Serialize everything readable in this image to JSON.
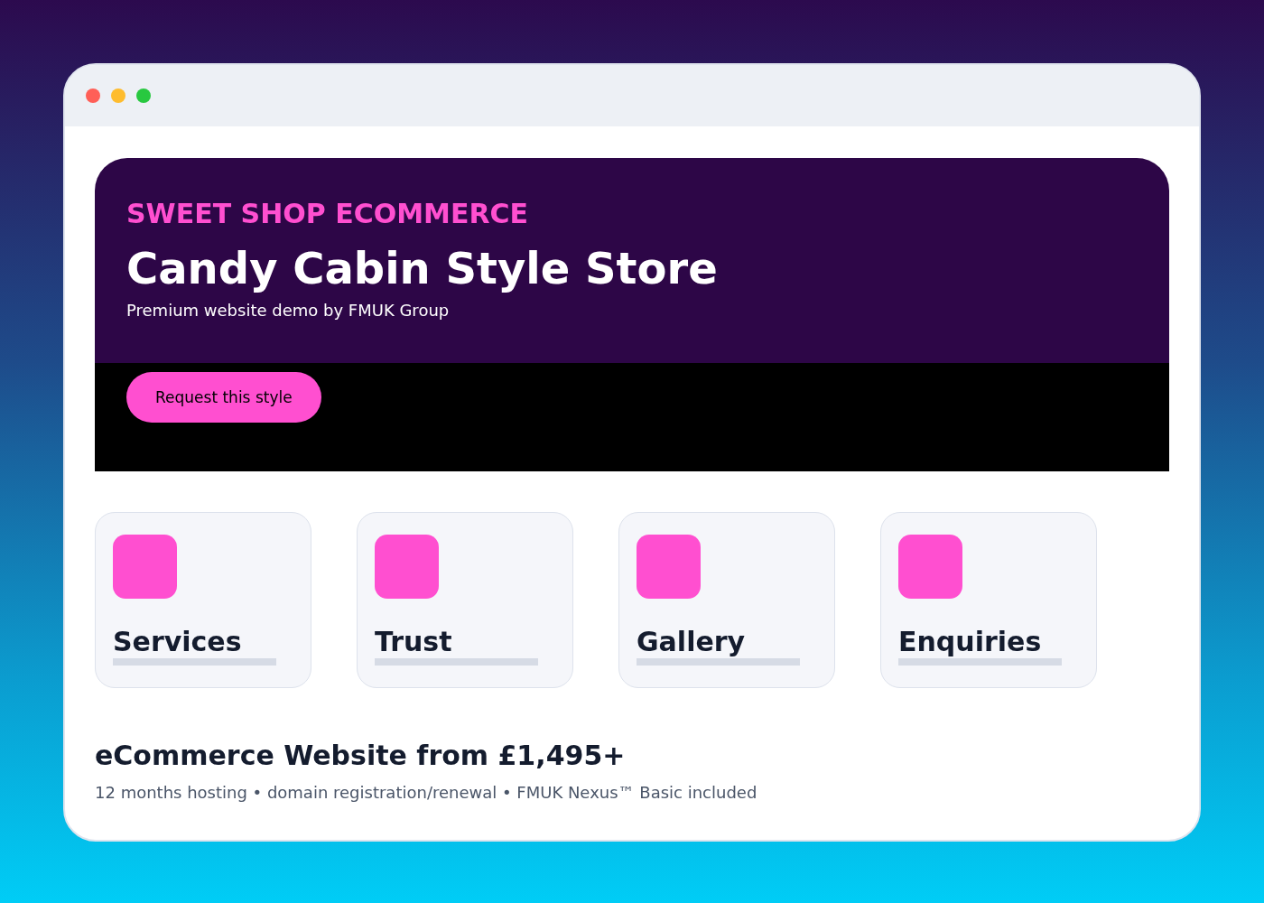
{
  "window": {
    "controls": [
      {
        "color": "#ff5f57"
      },
      {
        "color": "#febc2e"
      },
      {
        "color": "#28c840"
      }
    ]
  },
  "hero": {
    "kicker": "SWEET SHOP ECOMMERCE",
    "title": "Candy Cabin Style Store",
    "subtitle": "Premium website demo by FMUK Group",
    "button": "Request this style"
  },
  "cards": [
    {
      "label": "Services"
    },
    {
      "label": "Trust"
    },
    {
      "label": "Gallery"
    },
    {
      "label": "Enquiries"
    }
  ],
  "pricing": {
    "heading": "eCommerce Website from £1,495+",
    "details": "12 months hosting • domain registration/renewal • FMUK Nexus™ Basic included"
  }
}
